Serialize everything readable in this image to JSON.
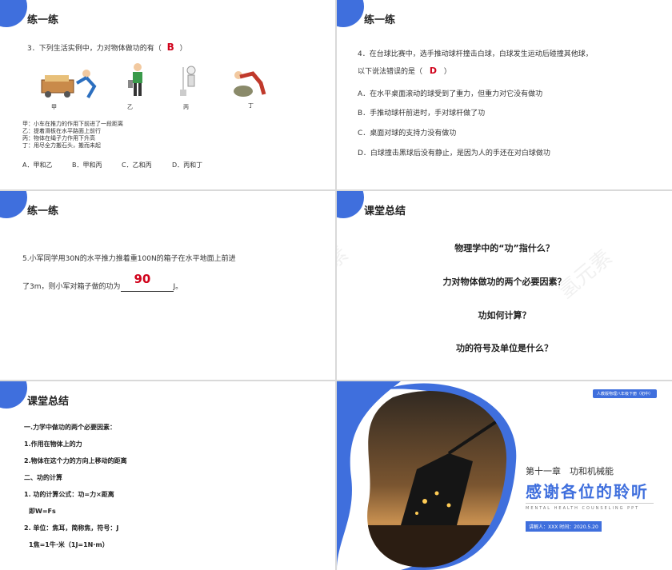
{
  "slide1": {
    "title": "练一练",
    "question": "3．下列生活实例中，力对物体做功的有（",
    "question_end": "）",
    "answer": "B",
    "figure_labels": [
      "甲",
      "乙",
      "丙",
      "丁"
    ],
    "descriptions": [
      "甲：小车在推力的作用下前进了一段距离",
      "乙：提着滑板在水平路面上前行",
      "丙：物体在绳子力作用下升高",
      "丁：用尽全力搬石头，搬而未起"
    ],
    "options": [
      "A．甲和乙",
      "B．甲和丙",
      "C．乙和丙",
      "D．丙和丁"
    ]
  },
  "slide2": {
    "title": "练一练",
    "question_line1": "4．在台球比赛中，选手推动球杆撞击白球，白球发生运动后碰撞其他球，",
    "question_line2": "以下说法错误的是（",
    "question_end": "）",
    "answer": "D",
    "options": [
      "A．在水平桌面滚动的球受到了重力，但重力对它没有做功",
      "B．手推动球杆前进时，手对球杆做了功",
      "C．桌面对球的支持力没有做功",
      "D．白球撞击黑球后没有静止，是因为人的手还在对白球做功"
    ]
  },
  "slide3": {
    "title": "练一练",
    "line1": "5.小军同学用30N的水平推力推着重100N的箱子在水平地面上前进",
    "line2_pre": "了3m，则小军对箱子做的功为",
    "line2_post": "J。",
    "answer": "90"
  },
  "slide4": {
    "title": "课堂总结",
    "questions": [
      "物理学中的“功”指什么？",
      "力对物体做功的两个必要因素？",
      "功如何计算？",
      "功的符号及单位是什么？"
    ],
    "chevron_colors": [
      "#d63384",
      "#2db34a",
      "#f0a868"
    ],
    "watermark": "氢元素"
  },
  "slide5": {
    "title": "课堂总结",
    "lines": [
      "一.力学中做功的两个必要因素：",
      "1.作用在物体上的力",
      "2.物体在这个力的方向上移动的距离",
      "二、功的计算",
      "1. 功的计算公式：功=力×距离",
      "即W=Fs",
      "2. 单位：焦耳，简称焦，符号：J",
      "1焦=1牛·米（1J=1N·m）"
    ]
  },
  "slide6": {
    "badge": "人教版物理八年级下册（初中）",
    "chapter": "第十一章　功和机械能",
    "thanks": "感谢各位的聆听",
    "english": "MENTAL HEALTH COUNSELING PPT",
    "speaker": "讲解人：XXX  时间：2020.5.20"
  },
  "colors": {
    "accent": "#3f6fdd",
    "answer": "#d0021b"
  }
}
